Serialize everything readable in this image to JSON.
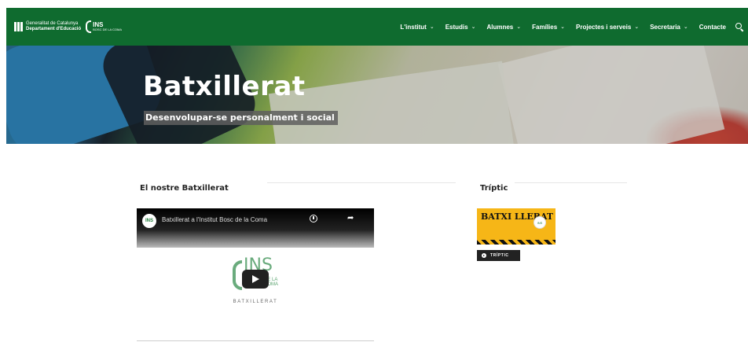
{
  "header": {
    "gen_logo_line1": "Generalitat de Catalunya",
    "gen_logo_line2": "Departament d'Educació",
    "ins_logo": "INS",
    "ins_logo_sub": "BOSC DE LA COMA",
    "menu": [
      {
        "label": "L'institut"
      },
      {
        "label": "Estudis"
      },
      {
        "label": "Alumnes"
      },
      {
        "label": "Famílies"
      },
      {
        "label": "Projectes i serveis"
      },
      {
        "label": "Secretaria"
      },
      {
        "label": "Contacte"
      }
    ],
    "chevron": "⌄"
  },
  "hero": {
    "title": "Batxillerat",
    "subtitle": "Desenvolupar-se personalment i social"
  },
  "main": {
    "section_title": "El nostre Batxillerat",
    "video": {
      "avatar_text": "INS",
      "title": "Batxillerat a l'Institut Bosc de la Coma",
      "logo_text": "INS",
      "logo_sub": "DE LA COMA",
      "caption": "BATXILLERAT"
    }
  },
  "sidebar": {
    "section_title": "Tríptic",
    "brochure_title": "BATXI LLERAT",
    "brochure_circle": "INS",
    "button_label": "TRÍPTIC"
  },
  "colors": {
    "nav_bg": "#0f6b2f",
    "brochure_yellow": "#f6b617"
  }
}
